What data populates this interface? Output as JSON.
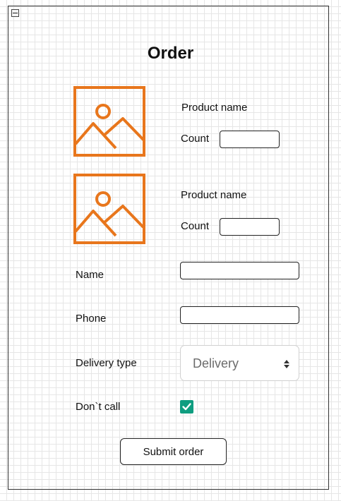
{
  "form": {
    "title": "Order",
    "products": [
      {
        "name_label": "Product name",
        "count_label": "Count",
        "count_value": ""
      },
      {
        "name_label": "Product name",
        "count_label": "Count",
        "count_value": ""
      }
    ],
    "name_label": "Name",
    "name_value": "",
    "phone_label": "Phone",
    "phone_value": "",
    "delivery_label": "Delivery type",
    "delivery_value": "Delivery",
    "dont_call_label": "Don`t call",
    "dont_call_checked": true,
    "submit_label": "Submit order"
  },
  "icons": {
    "collapse": "minus-square-icon",
    "product_image": "image-placeholder-icon",
    "select_arrows": "sort-arrows-icon",
    "checkbox": "checkmark-icon"
  },
  "colors": {
    "image_placeholder": "#e8761c",
    "checkbox_checked": "#0f9d80",
    "select_text": "#6c6c6c"
  }
}
